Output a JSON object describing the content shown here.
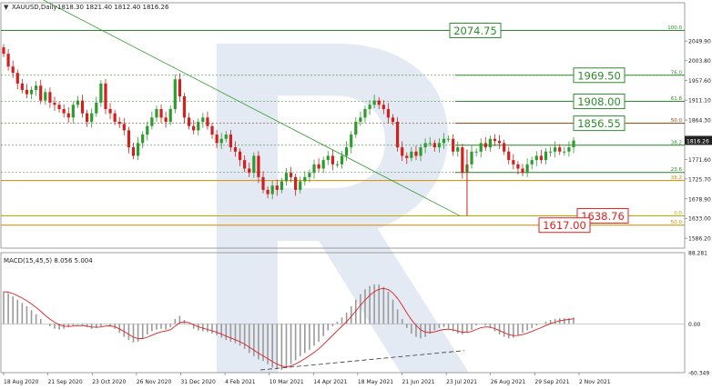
{
  "chart_data": [
    {
      "type": "candlestick",
      "header": {
        "symbol": "XAUUSD,Daily",
        "ohlc": "1818.30 1821.40 1812.40 1816.26"
      },
      "ylim": [
        1563,
        2140
      ],
      "current_price": "1816.26",
      "y_ticks": [
        {
          "label": "2049.90",
          "v": 2049.9
        },
        {
          "label": "2003.80",
          "v": 2003.8
        },
        {
          "label": "1957.60",
          "v": 1957.6
        },
        {
          "label": "1911.10",
          "v": 1911.1
        },
        {
          "label": "1864.30",
          "v": 1864.3
        },
        {
          "label": "1771.60",
          "v": 1771.6
        },
        {
          "label": "1725.70",
          "v": 1725.7
        },
        {
          "label": "1678.90",
          "v": 1678.9
        },
        {
          "label": "1633.00",
          "v": 1633.0
        },
        {
          "label": "1586.20",
          "v": 1586.2
        }
      ],
      "x_ticks": [
        "18 Aug 2020",
        "21 Sep 2020",
        "23 Oct 2020",
        "26 Nov 2020",
        "31 Dec 2020",
        "4 Feb 2021",
        "10 Mar 2021",
        "14 Apr 2021",
        "18 May 2021",
        "21 Jun 2021",
        "23 Jul 2021",
        "26 Aug 2021",
        "29 Sep 2021",
        "2 Nov 2021"
      ],
      "fib_levels": [
        {
          "label": "100.0",
          "price": 2074.75,
          "color": "#2e8b2e"
        },
        {
          "label": "76.0",
          "price": 1969.5,
          "color": "#2e8b2e"
        },
        {
          "label": "61.8",
          "price": 1908.0,
          "color": "#2e8b2e"
        },
        {
          "label": "50.0",
          "price": 1856.55,
          "color": "#8b4513"
        },
        {
          "label": "38.2",
          "price": 1805.0,
          "color": "#2e8b2e"
        },
        {
          "label": "23.6",
          "price": 1741.0,
          "color": "#2e8b2e"
        },
        {
          "label": "38.2",
          "price": 1722.0,
          "color": "#d98c00"
        },
        {
          "label": "0.0",
          "price": 1638.76,
          "color": "#b8a800"
        },
        {
          "label": "50.0",
          "price": 1617.0,
          "color": "#d98c00"
        }
      ],
      "target_boxes": [
        {
          "label": "2074.75",
          "price": 2074.75,
          "color": "#2e8b2e"
        },
        {
          "label": "1969.50",
          "price": 1969.5,
          "color": "#2e8b2e"
        },
        {
          "label": "1908.00",
          "price": 1908.0,
          "color": "#2e8b2e"
        },
        {
          "label": "1856.55",
          "price": 1856.55,
          "color": "#2e8b2e"
        },
        {
          "label": "1638.76",
          "price": 1638.76,
          "color": "#e02020"
        },
        {
          "label": "1617.00",
          "price": 1617.0,
          "color": "#e02020"
        }
      ],
      "trendline": {
        "from": [
          "18 Aug 2020",
          2070
        ],
        "to": [
          "23 Jul 2021",
          1638.76
        ]
      },
      "close_series": [
        2020,
        1990,
        1975,
        1950,
        1935,
        1925,
        1935,
        1945,
        1910,
        1930,
        1905,
        1900,
        1890,
        1880,
        1870,
        1900,
        1910,
        1880,
        1860,
        1880,
        1905,
        1950,
        1890,
        1880,
        1860,
        1855,
        1840,
        1800,
        1780,
        1810,
        1830,
        1850,
        1870,
        1890,
        1870,
        1860,
        1890,
        1960,
        1920,
        1870,
        1850,
        1840,
        1860,
        1870,
        1850,
        1830,
        1810,
        1820,
        1830,
        1800,
        1790,
        1770,
        1750,
        1740,
        1780,
        1730,
        1700,
        1690,
        1710,
        1700,
        1720,
        1740,
        1730,
        1700,
        1720,
        1730,
        1740,
        1760,
        1750,
        1770,
        1780,
        1760,
        1760,
        1780,
        1800,
        1830,
        1860,
        1870,
        1890,
        1900,
        1910,
        1900,
        1890,
        1870,
        1860,
        1800,
        1780,
        1775,
        1790,
        1780,
        1800,
        1810,
        1810,
        1800,
        1810,
        1820,
        1820,
        1790,
        1800,
        1740,
        1760,
        1790,
        1790,
        1810,
        1800,
        1820,
        1815,
        1810,
        1790,
        1770,
        1760,
        1750,
        1740,
        1760,
        1770,
        1780,
        1770,
        1790,
        1790,
        1800,
        1790,
        1790,
        1800,
        1816
      ]
    },
    {
      "type": "histogram",
      "title": "MACD(15,45,5) 8.056 5.004",
      "ylim": [
        -60.349,
        88.281
      ],
      "y_ticks": [
        {
          "label": "88.281",
          "v": 88.281
        },
        {
          "label": "0.00",
          "v": 0
        },
        {
          "label": "-60.349",
          "v": -60.349
        }
      ],
      "macd_series": [
        40,
        38,
        34,
        30,
        26,
        22,
        17,
        12,
        6,
        0,
        -3,
        -6,
        -7,
        -6,
        -4,
        -2,
        -1,
        -2,
        -4,
        -6,
        -5,
        -3,
        0,
        -2,
        -6,
        -11,
        -16,
        -20,
        -23,
        -22,
        -18,
        -13,
        -9,
        -7,
        -6,
        -7,
        -4,
        6,
        10,
        5,
        -1,
        -6,
        -8,
        -9,
        -10,
        -12,
        -14,
        -17,
        -20,
        -22,
        -24,
        -27,
        -31,
        -36,
        -40,
        -44,
        -46,
        -50,
        -54,
        -56,
        -57,
        -55,
        -50,
        -45,
        -40,
        -36,
        -32,
        -27,
        -22,
        -15,
        -8,
        -3,
        3,
        8,
        14,
        22,
        30,
        37,
        43,
        47,
        49,
        49,
        46,
        40,
        30,
        18,
        6,
        -5,
        -12,
        -16,
        -18,
        -16,
        -12,
        -8,
        -5,
        -4,
        -6,
        -9,
        -12,
        -13,
        -11,
        -7,
        -2,
        0,
        -2,
        -5,
        -9,
        -13,
        -16,
        -18,
        -17,
        -14,
        -11,
        -8,
        -5,
        -2,
        0,
        3,
        5,
        6,
        7,
        7,
        7,
        8
      ],
      "divergence_line": {
        "from": [
          "10 Mar 2021",
          -57
        ],
        "to": [
          "23 Jul 2021",
          -33
        ]
      }
    }
  ]
}
